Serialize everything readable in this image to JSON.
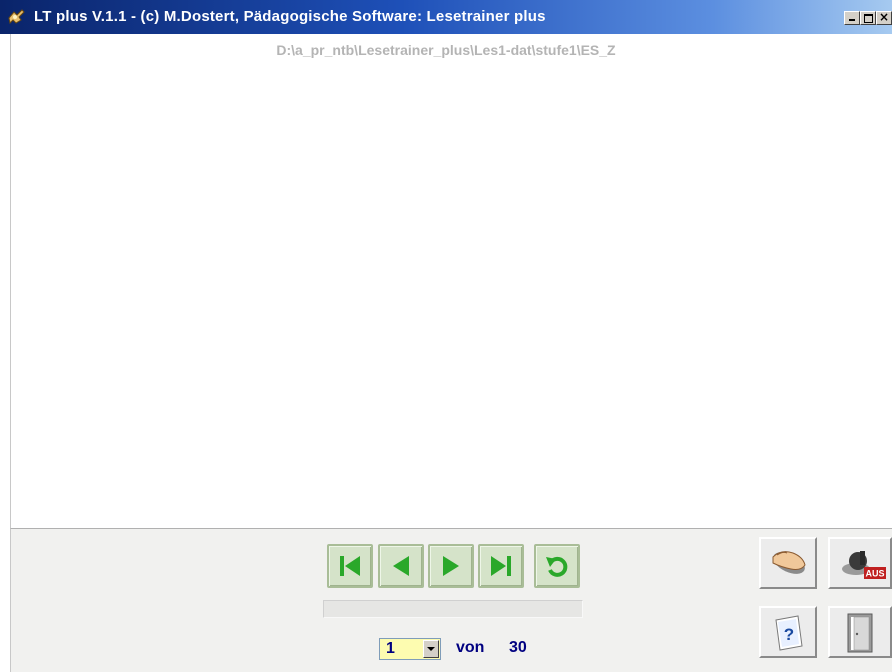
{
  "window": {
    "title": "LT plus   V.1.1 - (c) M.Dostert, Pädagogische Software: Lesetrainer plus",
    "icon": "app-icon",
    "controls": [
      "minimize",
      "maximize",
      "close"
    ]
  },
  "content": {
    "path": "D:\\a_pr_ntb\\Lesetrainer_plus\\Les1-dat\\stufe1\\ES_Z"
  },
  "navigation": {
    "buttons": [
      "first-page-icon",
      "previous-page-icon",
      "next-page-icon",
      "last-page-icon",
      "reset-icon"
    ],
    "progress": 0
  },
  "pager": {
    "current_page": "1",
    "von_label": "von",
    "total_pages": "30"
  },
  "tools": {
    "icons": [
      "mouse-hand-icon",
      "sound-off-icon",
      "help-icon",
      "exit-door-icon"
    ],
    "aus_label": "AUS"
  },
  "colors": {
    "title_gradient_start": "#0a246a",
    "nav_button_green": "#28a028",
    "pager_text": "#000080",
    "page_select_bg": "#fdfcb0",
    "path_text": "#b4b4b4"
  }
}
